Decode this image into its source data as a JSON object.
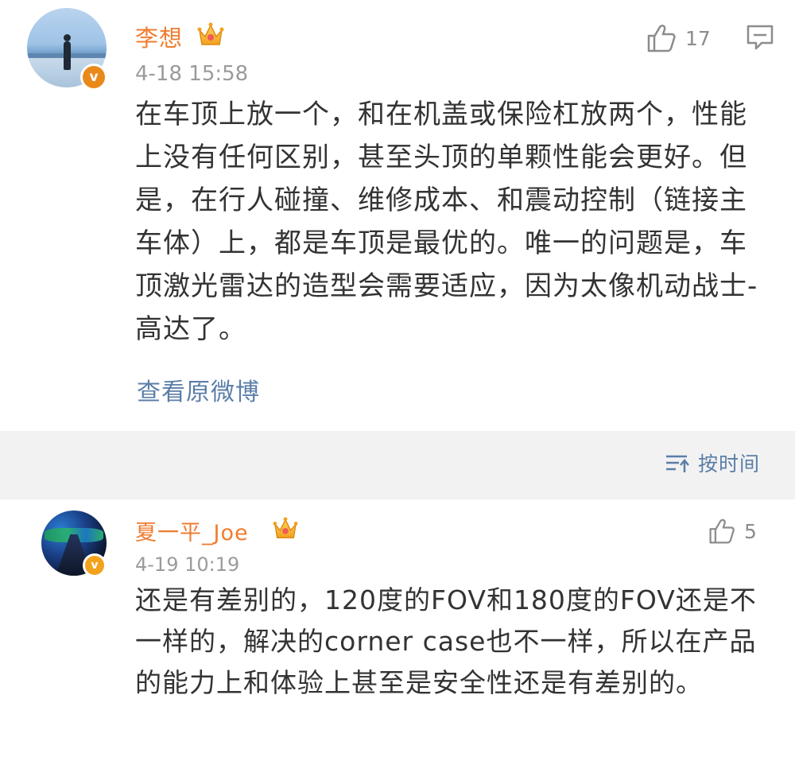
{
  "post": {
    "author": "李想",
    "timestamp": "4-18 15:58",
    "text": "在车顶上放一个，和在机盖或保险杠放两个，性能上没有任何区别，甚至头顶的单颗性能会更好。但是，在行人碰撞、维修成本、和震动控制（链接主车体）上，都是车顶是最优的。唯一的问题是，车顶激光雷达的造型会需要适应，因为太像机动战士-高达了。",
    "like_count": "17",
    "view_original_label": "查看原微博"
  },
  "sort": {
    "label": "按时间"
  },
  "comment": {
    "author": "夏一平_Joe",
    "timestamp": "4-19 10:19",
    "text": "还是有差别的，120度的FOV和180度的FOV还是不一样的，解决的corner case也不一样，所以在产品的能力上和体验上甚至是安全性还是有差别的。",
    "like_count": "5"
  },
  "colors": {
    "username": "#ef7d30",
    "link": "#5b7ea8",
    "timestamp": "#9b9b9b",
    "band": "#f2f2f2"
  },
  "icons": [
    "thumbs-up-icon",
    "comment-icon",
    "sort-icon",
    "crown-icon",
    "verified-badge-icon"
  ]
}
